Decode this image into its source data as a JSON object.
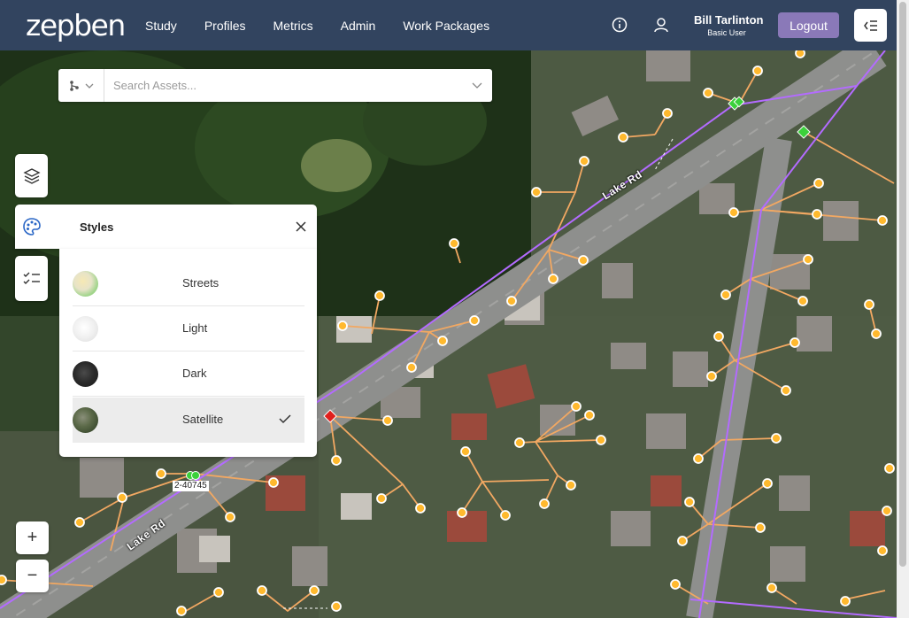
{
  "app": {
    "logo_text": "zepben",
    "brand_color": "#32445f",
    "accent_color": "#8a79b8"
  },
  "nav": {
    "items": [
      "Study",
      "Profiles",
      "Metrics",
      "Admin",
      "Work Packages"
    ]
  },
  "header": {
    "info_icon": "info-icon",
    "user_icon": "user-icon",
    "user_name": "Bill Tarlinton",
    "user_role": "Basic User",
    "logout_label": "Logout",
    "menu_icon": "collapse-menu-icon"
  },
  "search": {
    "placeholder": "Search Assets...",
    "type_icon": "network-tree-icon"
  },
  "tools": {
    "layers_icon": "layers-icon",
    "styles_icon": "palette-icon",
    "checklist_icon": "checklist-icon"
  },
  "styles_panel": {
    "title": "Styles",
    "options": [
      {
        "label": "Streets",
        "selected": false
      },
      {
        "label": "Light",
        "selected": false
      },
      {
        "label": "Dark",
        "selected": false
      },
      {
        "label": "Satellite",
        "selected": true
      }
    ]
  },
  "map": {
    "road_labels": [
      "Lake Rd",
      "Lake Rd"
    ],
    "asset_label": "2-40745",
    "colors": {
      "hv_line": "#b36bff",
      "lv_line": "#f2a862",
      "pole": "#ffb92e",
      "switch_green": "#3bd13b",
      "switch_red": "#e0201d"
    }
  },
  "zoom": {
    "in_label": "+",
    "out_label": "−"
  }
}
